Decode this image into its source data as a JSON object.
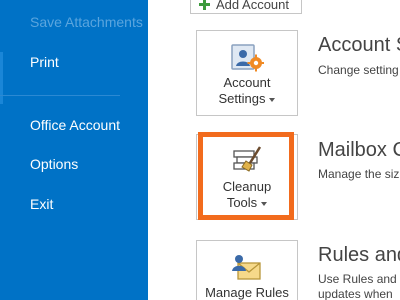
{
  "nav": {
    "items": [
      {
        "label": "Save Attachments",
        "state": "disabled"
      },
      {
        "label": "Print"
      },
      {
        "label": "Office Account"
      },
      {
        "label": "Options"
      },
      {
        "label": "Exit"
      }
    ],
    "background": "#0072c6"
  },
  "content": {
    "add_account": {
      "label": "Add Account",
      "icon": "plus-icon"
    },
    "tiles": [
      {
        "label_line1": "Account",
        "label_line2": "Settings",
        "icon": "account-settings-icon"
      },
      {
        "label_line1": "Cleanup",
        "label_line2": "Tools",
        "icon": "cleanup-tools-icon"
      },
      {
        "label_line1": "Manage Rules",
        "icon": "manage-rules-icon"
      }
    ],
    "sections": [
      {
        "title": "Account S",
        "desc_lines": [
          "Change setting"
        ]
      },
      {
        "title": "Mailbox C",
        "desc_lines": [
          "Manage the siz"
        ]
      },
      {
        "title": "Rules and",
        "desc_lines": [
          "Use Rules and",
          "updates when"
        ]
      }
    ],
    "highlight_color": "#f26b1d"
  }
}
